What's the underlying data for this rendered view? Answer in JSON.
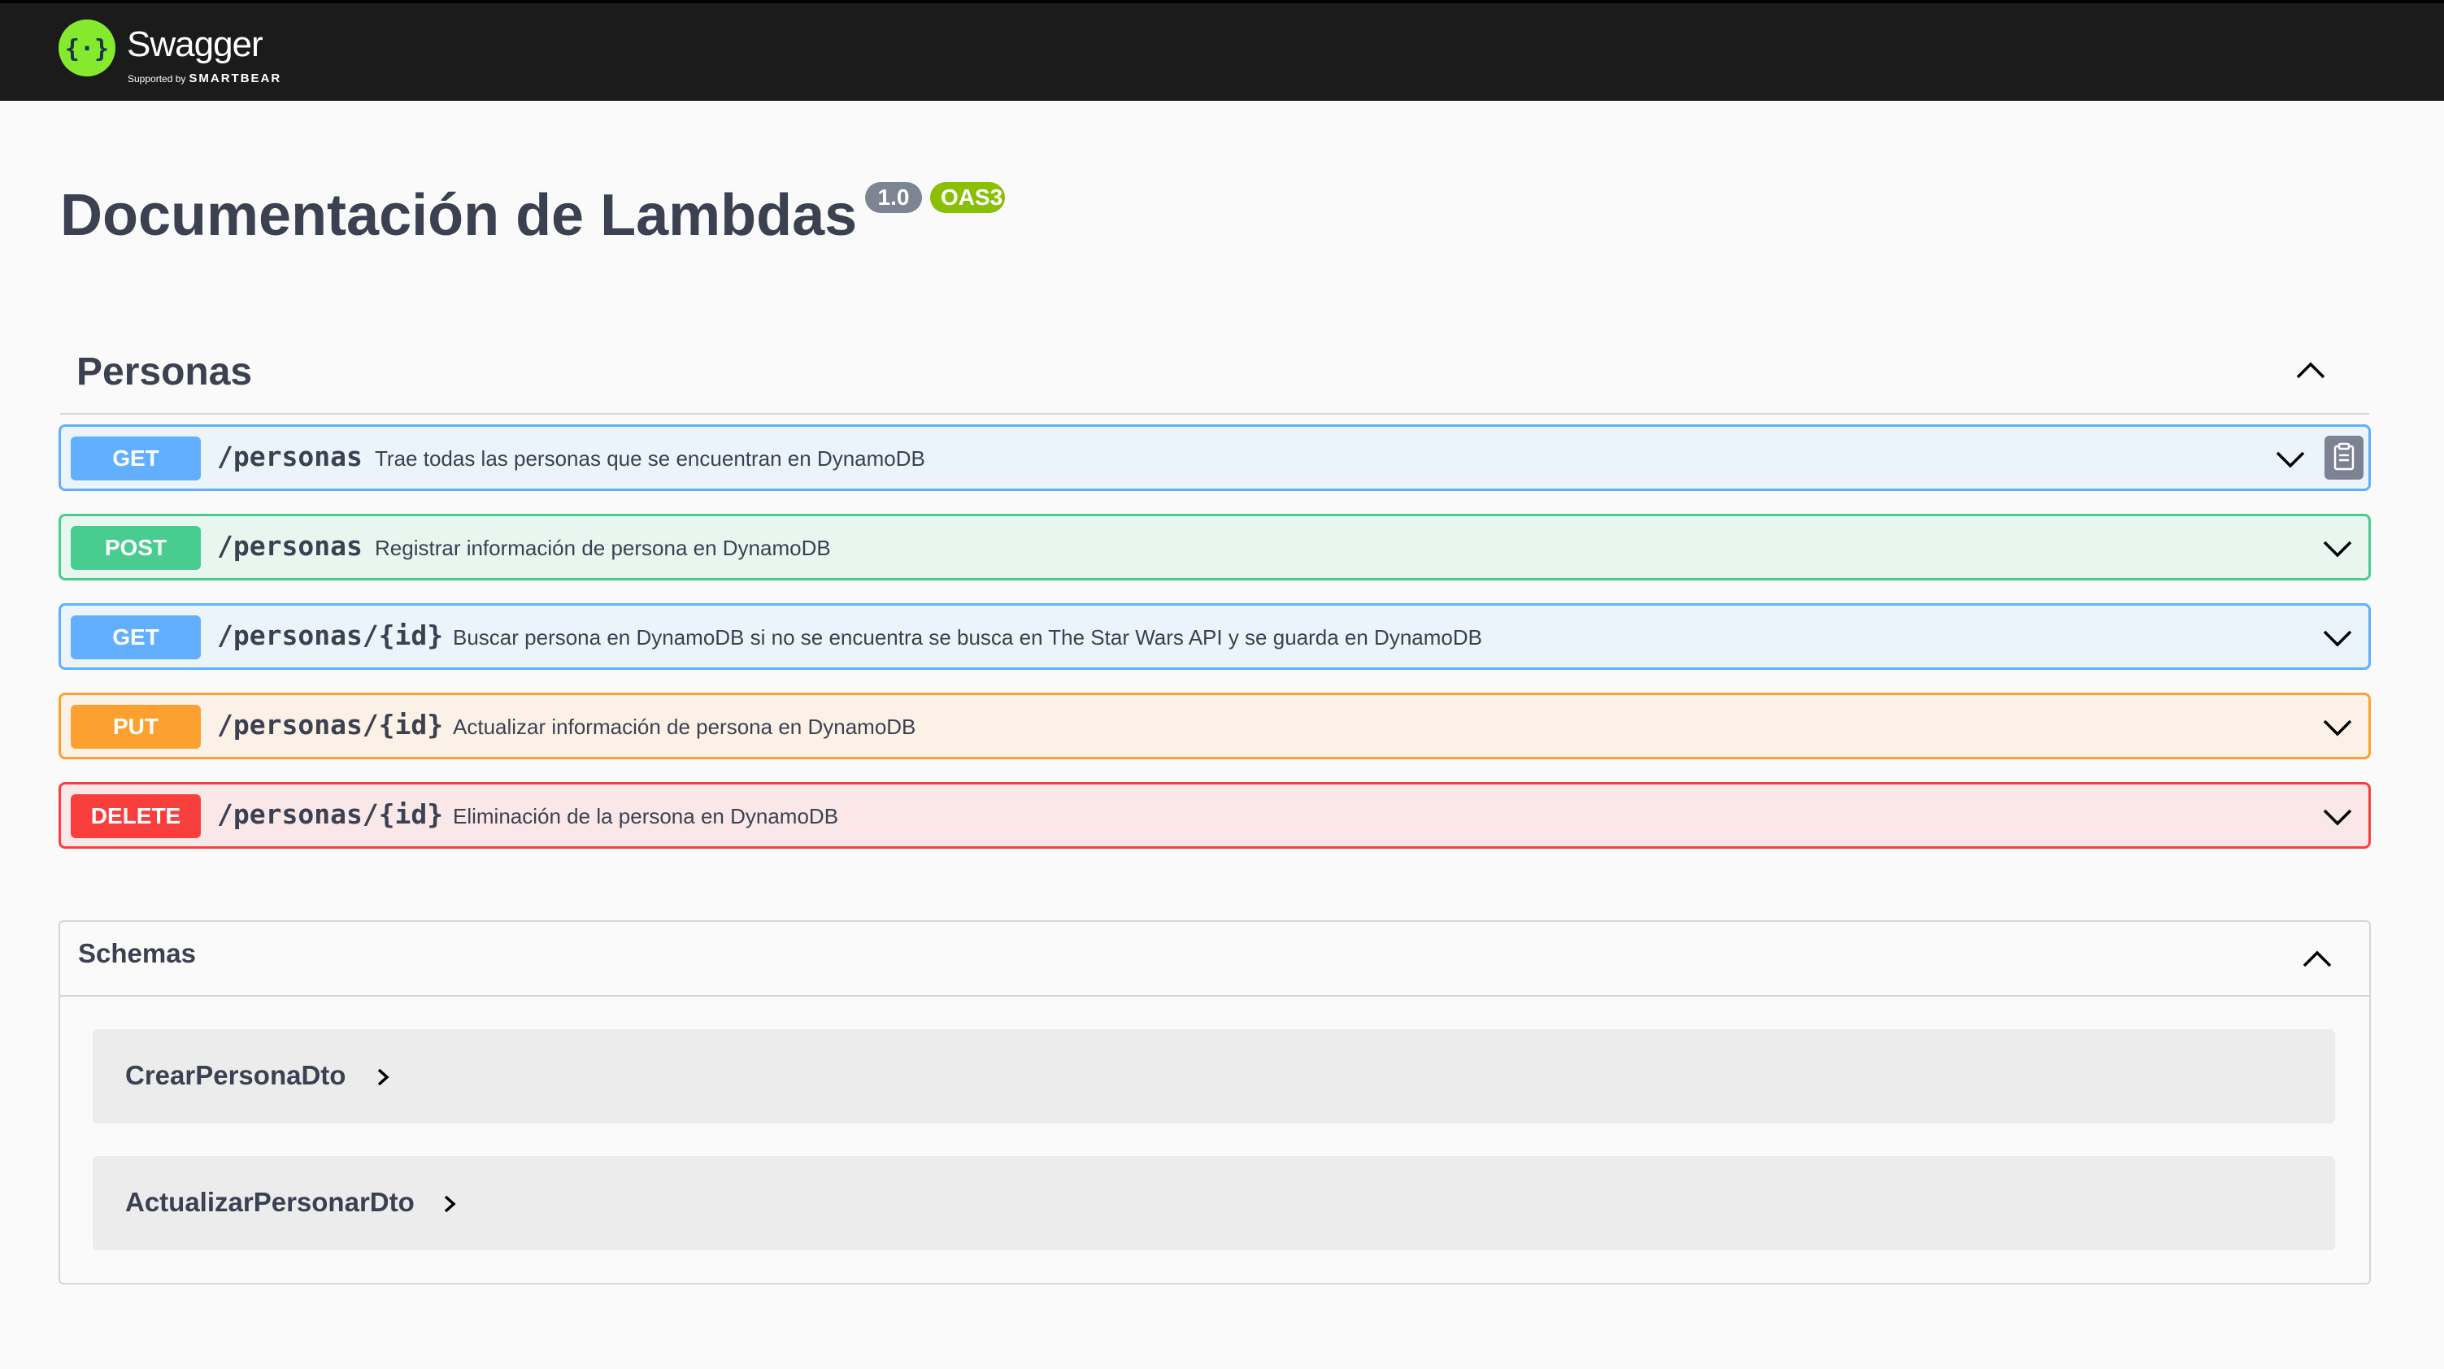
{
  "header": {
    "brand": "Swagger",
    "supported_by": "Supported by",
    "company": "SMARTBEAR"
  },
  "info": {
    "title": "Documentación de Lambdas",
    "version": "1.0",
    "oas": "OAS3"
  },
  "tag": {
    "name": "Personas"
  },
  "operations": [
    {
      "method": "GET",
      "path": "/personas",
      "summary": "Trae todas las personas que se encuentran en DynamoDB"
    },
    {
      "method": "POST",
      "path": "/personas",
      "summary": "Registrar información de persona en DynamoDB"
    },
    {
      "method": "GET",
      "path": "/personas/{id}",
      "summary": "Buscar persona en DynamoDB si no se encuentra se busca en The Star Wars API y se guarda en DynamoDB"
    },
    {
      "method": "PUT",
      "path": "/personas/{id}",
      "summary": "Actualizar información de persona en DynamoDB"
    },
    {
      "method": "DELETE",
      "path": "/personas/{id}",
      "summary": "Eliminación de la persona en DynamoDB"
    }
  ],
  "schemas": {
    "title": "Schemas",
    "models": [
      "CrearPersonaDto",
      "ActualizarPersonarDto"
    ]
  },
  "colors": {
    "get": "#61affe",
    "post": "#49cc90",
    "put": "#fca130",
    "delete": "#f93e3e",
    "topbar": "#1b1b1b",
    "logo": "#85ea2d"
  }
}
